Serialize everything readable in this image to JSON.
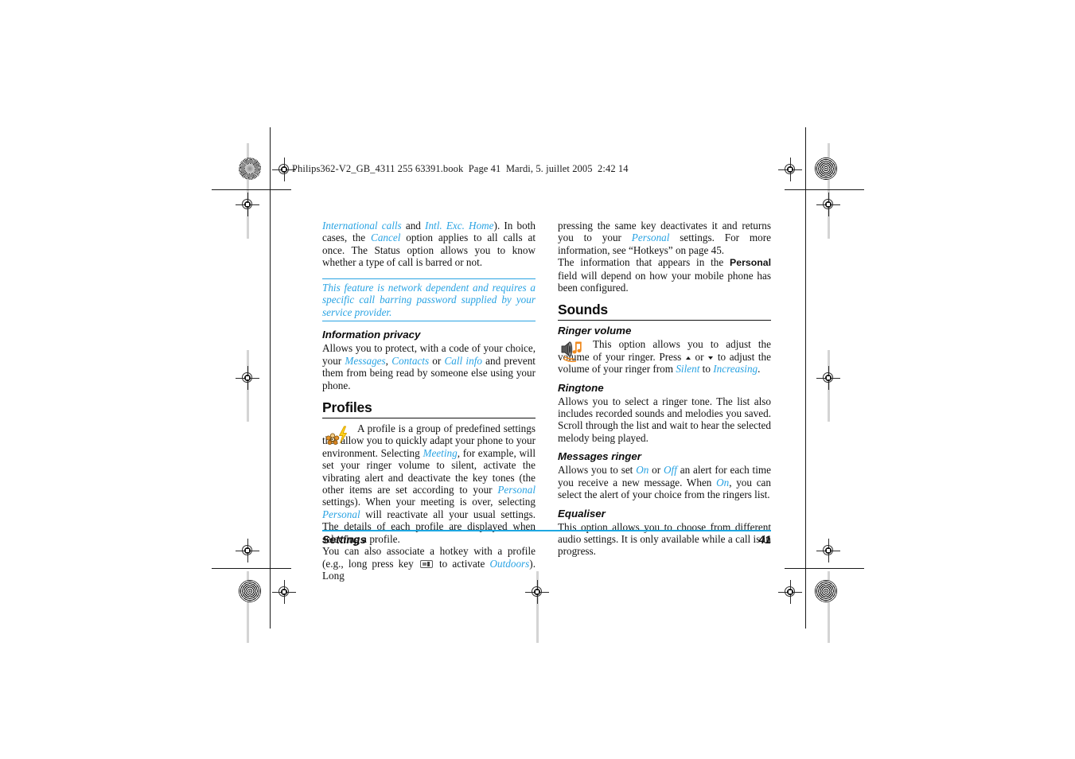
{
  "page": {
    "header_line": "Philips362-V2_GB_4311 255 63391.book  Page 41  Mardi, 5. juillet 2005  2:42 14",
    "footer_section": "Settings",
    "footer_page_number": "41",
    "accent_blue": "#29a3e3",
    "footer_rule_color": "#1ea7e1"
  },
  "left_column": {
    "para_1": {
      "seg_1_blue": "International calls",
      "seg_2": " and ",
      "seg_3_blue": "Intl. Exc. Home",
      "seg_4": "). In both cases, the ",
      "seg_5_blue": "Cancel",
      "seg_6": " option applies to all calls at once. The Status option allows you to know whether a type of call is barred or not."
    },
    "note": "This feature is network dependent and requires a specific call barring password supplied by your service provider.",
    "information_privacy": {
      "heading": "Information privacy",
      "seg_1": "Allows you to protect, with a code of your choice, your ",
      "seg_2_blue": "Messages",
      "seg_3": ", ",
      "seg_4_blue": "Contacts",
      "seg_5": " or ",
      "seg_6_blue": "Call info",
      "seg_7": " and prevent them from being read by someone else using your phone."
    },
    "profiles": {
      "heading": "Profiles",
      "icon": "profile-gear-lightning-icon",
      "seg_1": "A profile is a group of predefined settings that allow you to quickly adapt your phone to your environment. Selecting ",
      "seg_2_blue": "Meeting",
      "seg_3": ", for example, will set your ringer volume to silent, activate the vibrating alert and deactivate the key tones (the other items are set according to your ",
      "seg_4_blue": "Personal",
      "seg_5": " settings). When your meeting is over, selecting ",
      "seg_6_blue": "Personal",
      "seg_7": " will reactivate all your usual settings. The details of each profile are displayed when selecting a profile.",
      "para2_seg_1": "You can also associate a hotkey with a profile (e.g., long press key ",
      "para2_key_icon": "keypad-key-icon",
      "para2_seg_2": " to activate ",
      "para2_seg_3_blue": "Outdoors",
      "para2_seg_4": "). Long"
    }
  },
  "right_column": {
    "para_1": {
      "seg_1": "pressing the same key deactivates it and returns you to your ",
      "seg_2_blue": "Personal",
      "seg_3": " settings. For more information, see “Hotkeys” on page 45."
    },
    "para_2": {
      "seg_1": "The information that appears in the ",
      "seg_2_bold": "Personal",
      "seg_3": " field will depend on how your mobile phone has been configured."
    },
    "sounds": {
      "heading": "Sounds",
      "ringer_volume": {
        "heading": "Ringer volume",
        "icon": "speaker-music-note-icon",
        "seg_1": "This option allows you to adjust the volume of your ringer. Press ",
        "arrow_up": "up-triangle-icon",
        "seg_2": " or ",
        "arrow_down": "down-triangle-icon",
        "seg_3": " to adjust the volume of your ringer from ",
        "seg_4_blue": "Silent",
        "seg_5": " to ",
        "seg_6_blue": "Increasing",
        "seg_7": "."
      },
      "ringtone": {
        "heading": "Ringtone",
        "body": "Allows you to select a ringer tone. The list also includes recorded sounds and melodies you saved. Scroll through the list and wait to hear the selected melody being played."
      },
      "messages_ringer": {
        "heading": "Messages ringer",
        "seg_1": "Allows you to set ",
        "seg_2_blue": "On",
        "seg_3": " or ",
        "seg_4_blue": "Off",
        "seg_5": " an alert for each time you receive a new message. When ",
        "seg_6_blue": "On",
        "seg_7": ", you can select the alert of your choice from the ringers list."
      },
      "equaliser": {
        "heading": "Equaliser",
        "body": "This option allows you to choose from different audio settings. It is only available while a call is in progress."
      }
    }
  }
}
